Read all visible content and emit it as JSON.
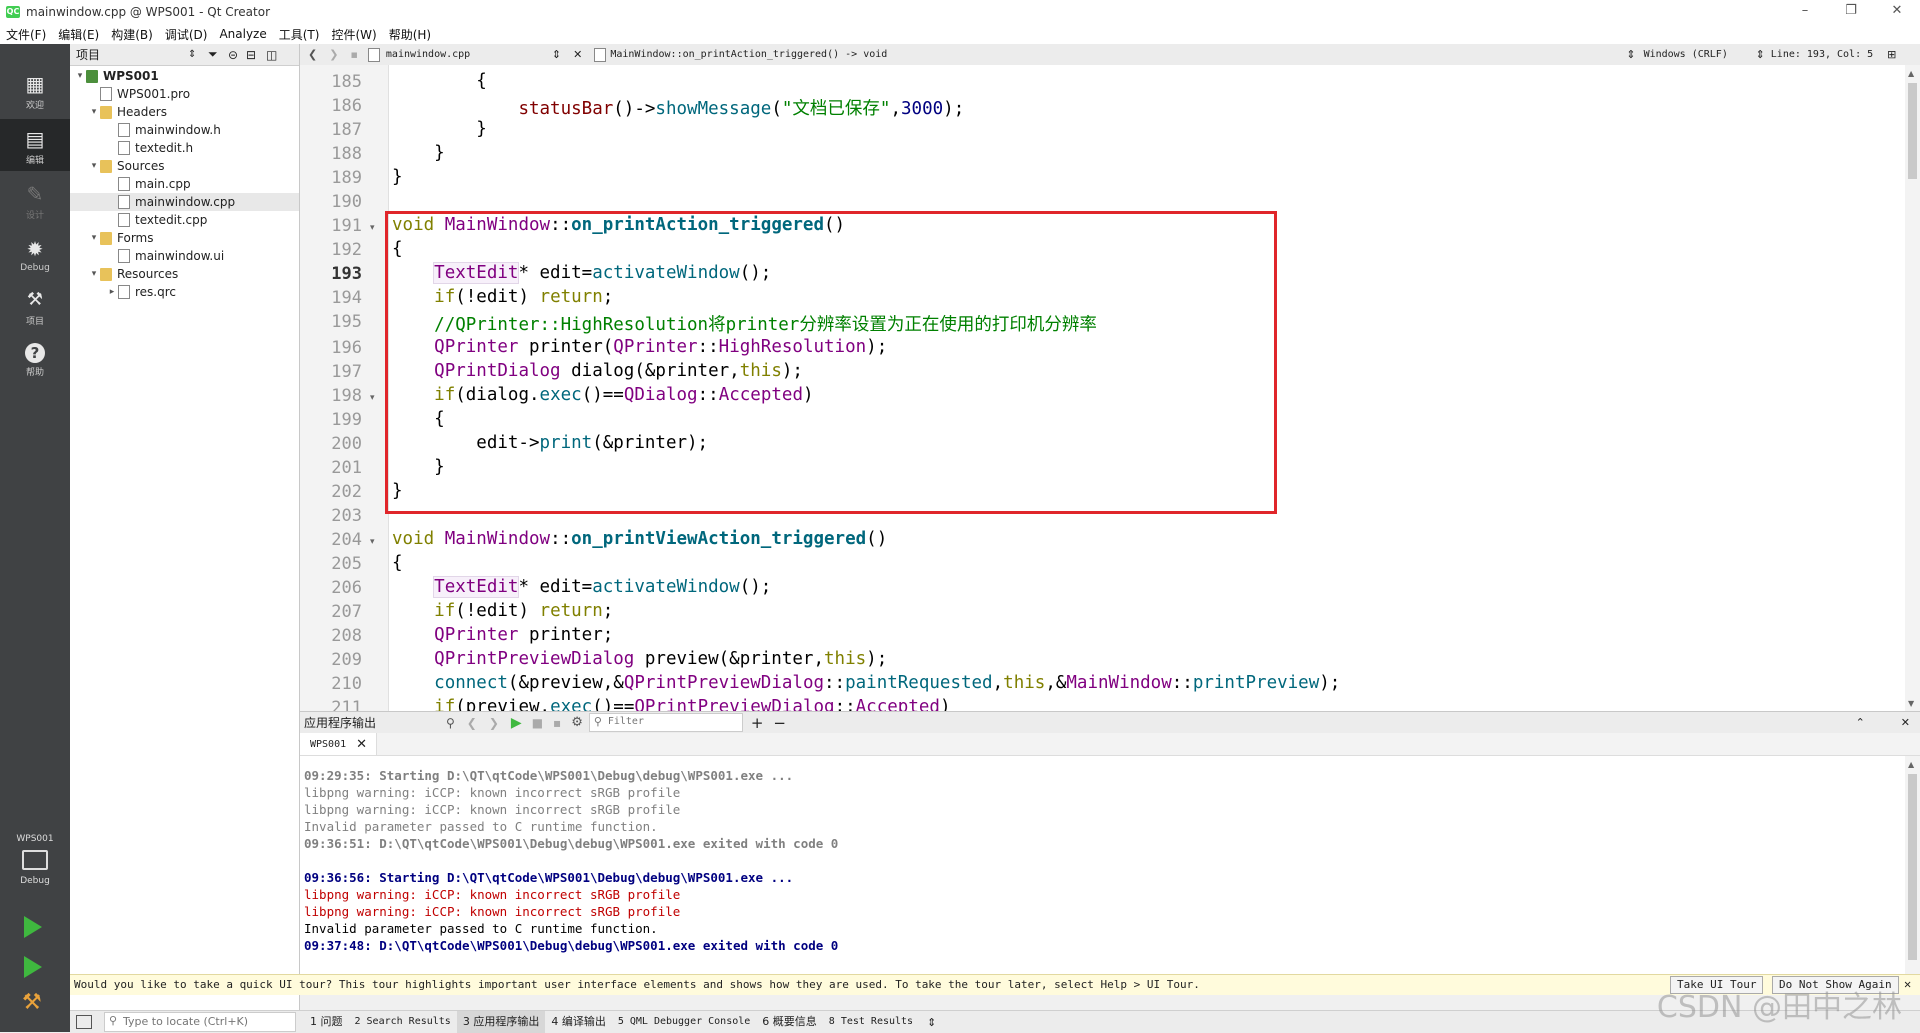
{
  "window": {
    "title": "mainwindow.cpp @ WPS001 - Qt Creator",
    "app_icon": "QC",
    "controls": [
      "–",
      "❐",
      "✕"
    ]
  },
  "menu": [
    "文件(F)",
    "编辑(E)",
    "构建(B)",
    "调试(D)",
    "Analyze",
    "工具(T)",
    "控件(W)",
    "帮助(H)"
  ],
  "modes": [
    {
      "label": "欢迎",
      "icon": "grid-icon",
      "glyph": "▦"
    },
    {
      "label": "编辑",
      "icon": "edit-icon",
      "glyph": "▤"
    },
    {
      "label": "设计",
      "icon": "pencil-icon",
      "glyph": "✎"
    },
    {
      "label": "Debug",
      "icon": "bug-icon",
      "glyph": "✹"
    },
    {
      "label": "项目",
      "icon": "wrench-icon",
      "glyph": "🔧"
    },
    {
      "label": "帮助",
      "icon": "help-icon",
      "glyph": "?"
    }
  ],
  "target": {
    "project": "WPS001",
    "config": "Debug"
  },
  "project_pane": {
    "title": "项目",
    "tree": [
      {
        "label": "WPS001",
        "type": "project"
      },
      {
        "label": "WPS001.pro",
        "type": "pro"
      },
      {
        "label": "Headers",
        "type": "folder"
      },
      {
        "label": "mainwindow.h",
        "type": "file"
      },
      {
        "label": "textedit.h",
        "type": "file"
      },
      {
        "label": "Sources",
        "type": "folder"
      },
      {
        "label": "main.cpp",
        "type": "file"
      },
      {
        "label": "mainwindow.cpp",
        "type": "file",
        "selected": true
      },
      {
        "label": "textedit.cpp",
        "type": "file"
      },
      {
        "label": "Forms",
        "type": "folder"
      },
      {
        "label": "mainwindow.ui",
        "type": "file"
      },
      {
        "label": "Resources",
        "type": "folder"
      },
      {
        "label": "res.qrc",
        "type": "file"
      }
    ]
  },
  "editor": {
    "file": "mainwindow.cpp",
    "symbol": "MainWindow::on_printAction_triggered() -> void",
    "line_ending": "Windows (CRLF)",
    "position": "Line: 193, Col: 5",
    "line_numbers": [
      "185",
      "186",
      "187",
      "188",
      "189",
      "190",
      "191",
      "192",
      "193",
      "194",
      "195",
      "196",
      "197",
      "198",
      "199",
      "200",
      "201",
      "202",
      "203",
      "204",
      "205",
      "206",
      "207",
      "208",
      "209",
      "210",
      "211"
    ],
    "current_line": "193"
  },
  "output": {
    "title": "应用程序输出",
    "filter_placeholder": "Filter",
    "tab": "WPS001",
    "lines": [
      {
        "text": "09:29:35: Starting D:\\QT\\qtCode\\WPS001\\Debug\\debug\\WPS001.exe ...",
        "style": "grayb"
      },
      {
        "text": "libpng warning: iCCP: known incorrect sRGB profile",
        "style": "gray"
      },
      {
        "text": "libpng warning: iCCP: known incorrect sRGB profile",
        "style": "gray"
      },
      {
        "text": "Invalid parameter passed to C runtime function.",
        "style": "gray"
      },
      {
        "text": "09:36:51: D:\\QT\\qtCode\\WPS001\\Debug\\debug\\WPS001.exe exited with code 0",
        "style": "grayb"
      },
      {
        "text": "",
        "style": "gray"
      },
      {
        "text": "09:36:56: Starting D:\\QT\\qtCode\\WPS001\\Debug\\debug\\WPS001.exe ...",
        "style": "blue"
      },
      {
        "text": "libpng warning: iCCP: known incorrect sRGB profile",
        "style": "red"
      },
      {
        "text": "libpng warning: iCCP: known incorrect sRGB profile",
        "style": "red"
      },
      {
        "text": "Invalid parameter passed to C runtime function.",
        "style": "black"
      },
      {
        "text": "09:37:48: D:\\QT\\qtCode\\WPS001\\Debug\\debug\\WPS001.exe exited with code 0",
        "style": "blue"
      }
    ]
  },
  "tour": {
    "message": "Would you like to take a quick UI tour? This tour highlights important user interface elements and shows how they are used. To take the tour later, select Help > UI Tour.",
    "take_label": "Take UI Tour",
    "dismiss_label": "Do Not Show Again"
  },
  "status": {
    "locate_placeholder": "Type to locate (Ctrl+K)",
    "panes": [
      "1 问题",
      "2 Search Results",
      "3 应用程序输出",
      "4 编译输出",
      "5 QML Debugger Console",
      "6 概要信息",
      "8 Test Results"
    ],
    "active_pane": 2
  },
  "watermark": "CSDN @田中之林"
}
